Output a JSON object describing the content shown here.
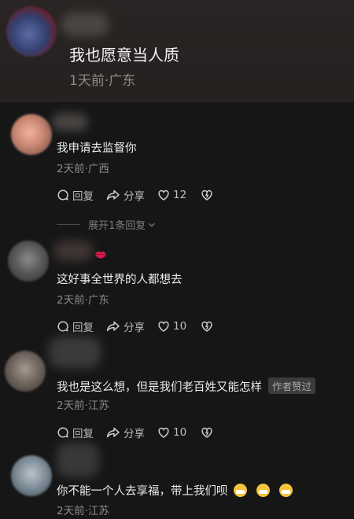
{
  "parent": {
    "text": "我也愿意当人质",
    "meta": "1天前·广东"
  },
  "comments": [
    {
      "text": "我申请去监督你",
      "meta": "2天前·广西",
      "reply_label": "回复",
      "share_label": "分享",
      "likes": "12",
      "expand_label": "展开1条回复"
    },
    {
      "text": "这好事全世界的人都想去",
      "meta": "2天前·广东",
      "reply_label": "回复",
      "share_label": "分享",
      "likes": "10"
    },
    {
      "text": "我也是这么想，但是我们老百姓又能怎样",
      "badge": "作者赞过",
      "meta": "2天前·江苏",
      "reply_label": "回复",
      "share_label": "分享",
      "likes": "10"
    },
    {
      "text": "你不能一个人去享福，带上我们呗",
      "meta": "2天前·江苏"
    }
  ],
  "icons": [
    "comment-icon",
    "share-icon",
    "heart-icon",
    "dislike-heart-icon",
    "chevron-down-icon",
    "lips-icon",
    "grin-emoji-icon"
  ]
}
